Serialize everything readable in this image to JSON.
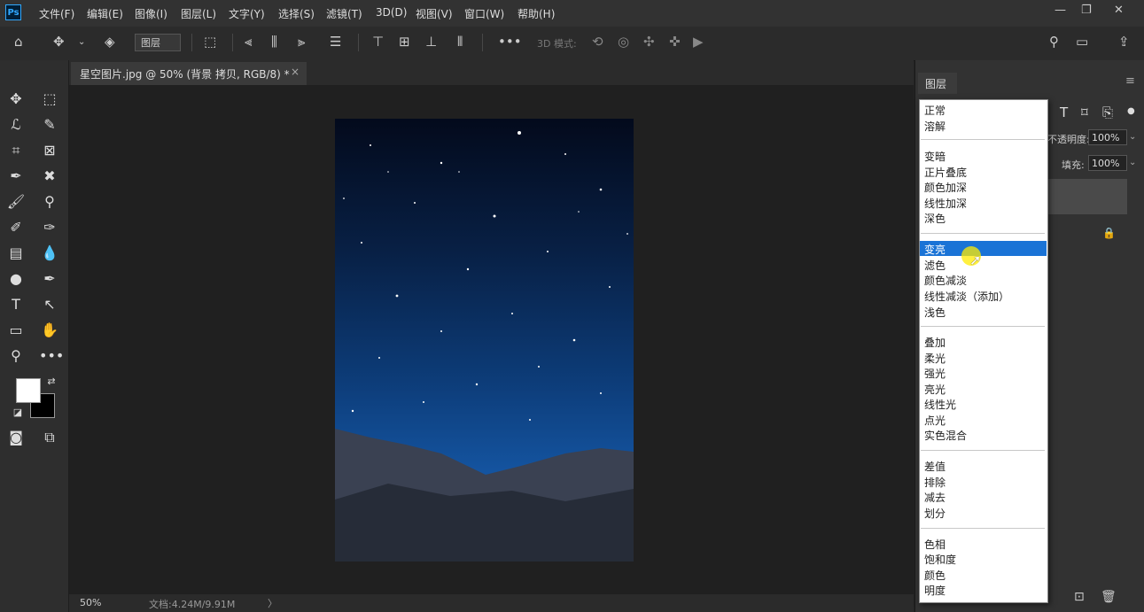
{
  "app": {
    "logo": "Ps"
  },
  "menu": [
    "文件(F)",
    "编辑(E)",
    "图像(I)",
    "图层(L)",
    "文字(Y)",
    "选择(S)",
    "滤镜(T)",
    "3D(D)",
    "视图(V)",
    "窗口(W)",
    "帮助(H)"
  ],
  "window_controls": {
    "minimize": "—",
    "restore": "❐",
    "close": "✕"
  },
  "options_bar": {
    "auto_select_target": "图层",
    "mode_3d_label": "3D 模式:"
  },
  "document_tab": {
    "title": "星空图片.jpg @ 50% (背景 拷贝, RGB/8) *",
    "close": "×"
  },
  "status": {
    "zoom": "50%",
    "doc_size": "文档:4.24M/9.91M",
    "arrow": "〉"
  },
  "layers_panel": {
    "tab": "图层",
    "opacity_label": "不透明度:",
    "opacity_value": "100%",
    "fill_label": "填充:",
    "fill_value": "100%"
  },
  "blend_modes": {
    "groups": [
      [
        "正常",
        "溶解"
      ],
      [
        "变暗",
        "正片叠底",
        "颜色加深",
        "线性加深",
        "深色"
      ],
      [
        "变亮",
        "滤色",
        "颜色减淡",
        "线性减淡（添加）",
        "浅色"
      ],
      [
        "叠加",
        "柔光",
        "强光",
        "亮光",
        "线性光",
        "点光",
        "实色混合"
      ],
      [
        "差值",
        "排除",
        "减去",
        "划分"
      ],
      [
        "色相",
        "饱和度",
        "颜色",
        "明度"
      ]
    ],
    "highlighted": "变亮"
  },
  "colors": {
    "accent": "#1a73d6",
    "ps_blue": "#31a8ff",
    "highlight_spot": "#ffeb00"
  }
}
